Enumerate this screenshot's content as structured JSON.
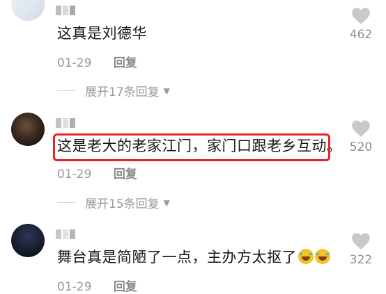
{
  "comments": [
    {
      "text": "这真是刘德华",
      "date": "01-29",
      "reply_label": "回复",
      "likes": "462",
      "expand_label": "展开17条回复"
    },
    {
      "text": "这是老大的老家江门，家门口跟老乡互动。",
      "date": "01-29",
      "reply_label": "回复",
      "likes": "520",
      "expand_label": "展开15条回复"
    },
    {
      "text": "舞台真是简陋了一点，主办方太抠了",
      "date": "01-29",
      "reply_label": "回复",
      "likes": "322",
      "emojis": [
        "laugh-cry-emoji",
        "laugh-cry-emoji"
      ]
    }
  ],
  "icons": {
    "like": "heart-icon",
    "expand": "chevron-down-icon"
  },
  "colors": {
    "highlight_border": "#e5242a",
    "muted_text": "#9a9a9a",
    "heart": "#c9c9c9"
  }
}
